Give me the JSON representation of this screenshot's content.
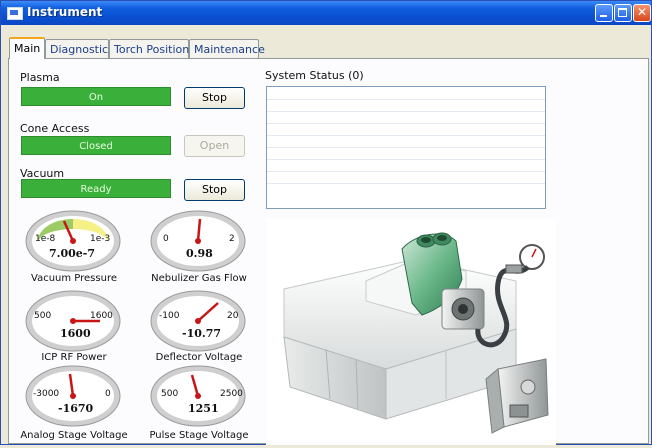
{
  "window": {
    "title": "Instrument",
    "colors": {
      "titlebar": "#0b58d8",
      "status_green": "#3aaf3a"
    }
  },
  "tabs": [
    {
      "label": "Main",
      "active": true
    },
    {
      "label": "Diagnostics",
      "active": false
    },
    {
      "label": "Torch Position",
      "active": false
    },
    {
      "label": "Maintenance",
      "active": false
    }
  ],
  "controls": {
    "plasma": {
      "label": "Plasma",
      "status": "On",
      "button": "Stop"
    },
    "cone": {
      "label": "Cone Access",
      "status": "Closed",
      "button": "Open"
    },
    "vacuum": {
      "label": "Vacuum",
      "status": "Ready",
      "button": "Stop"
    }
  },
  "system_status": {
    "title": "System Status (0)"
  },
  "gauges": [
    {
      "name": "Vacuum Pressure",
      "value": "7.00e-7",
      "min_label": "1e-8",
      "max_label": "1e-3"
    },
    {
      "name": "Nebulizer Gas Flow",
      "value": "0.98",
      "min_label": "0",
      "max_label": "2"
    },
    {
      "name": "ICP RF Power",
      "value": "1600",
      "min_label": "500",
      "max_label": "1600"
    },
    {
      "name": "Deflector Voltage",
      "value": "-10.77",
      "min_label": "-100",
      "max_label": "20"
    },
    {
      "name": "Analog Stage Voltage",
      "value": "-1670",
      "min_label": "-3000",
      "max_label": "0"
    },
    {
      "name": "Pulse Stage Voltage",
      "value": "1251",
      "min_label": "500",
      "max_label": "2500"
    }
  ]
}
